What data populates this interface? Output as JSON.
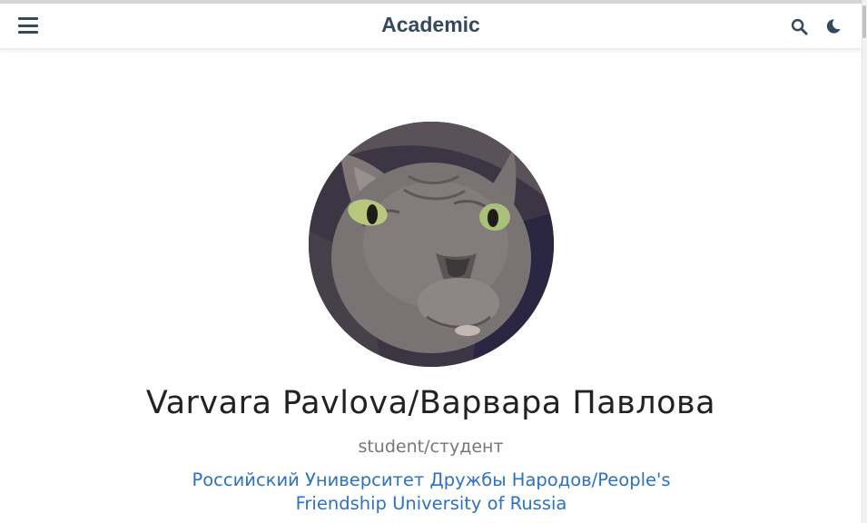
{
  "navbar": {
    "brand": "Academic",
    "menu_icon": "hamburger-menu-icon",
    "search_icon": "search-icon",
    "theme_icon": "moon-icon"
  },
  "profile": {
    "avatar": "cat-avatar-photo",
    "name": "Varvara Pavlova/Варвара Павлова",
    "role": "student/студент",
    "organization_line1": "Российский Университет Дружбы Народов/People's",
    "organization_line2": "Friendship University of Russia"
  },
  "colors": {
    "brand": "#34495e",
    "link": "#2b72c4",
    "name": "#222222",
    "role": "#777777"
  }
}
